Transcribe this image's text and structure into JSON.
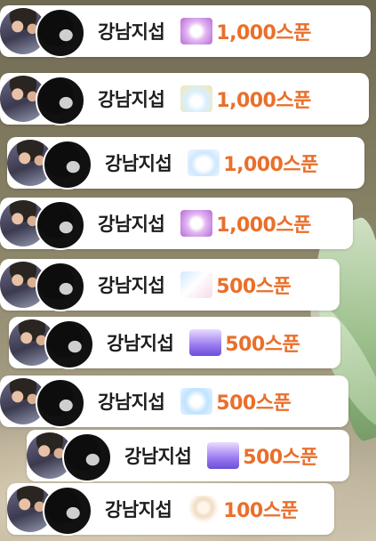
{
  "donations": [
    {
      "name": "강남지섭",
      "amount": "1,000스푼",
      "gift_icon": "purple-sparkle-gift-icon"
    },
    {
      "name": "강남지섭",
      "amount": "1,000스푼",
      "gift_icon": "sky-rainbow-gift-icon"
    },
    {
      "name": "강남지섭",
      "amount": "1,000스푼",
      "gift_icon": "cloud-gift-icon"
    },
    {
      "name": "강남지섭",
      "amount": "1,000스푼",
      "gift_icon": "purple-sparkle-gift-icon"
    },
    {
      "name": "강남지섭",
      "amount": "500스푼",
      "gift_icon": "blue-pink-gift-icon"
    },
    {
      "name": "강남지섭",
      "amount": "500스푼",
      "gift_icon": "violet-crown-gift-icon"
    },
    {
      "name": "강남지섭",
      "amount": "500스푼",
      "gift_icon": "glow-gift-icon"
    },
    {
      "name": "강남지섭",
      "amount": "500스푼",
      "gift_icon": "violet-crown-gift-icon"
    },
    {
      "name": "강남지섭",
      "amount": "100스푼",
      "gift_icon": "bear-gift-icon"
    }
  ],
  "colors": {
    "amount": "#ea6f2b",
    "name": "#1e1e1e",
    "card": "#ffffff"
  }
}
